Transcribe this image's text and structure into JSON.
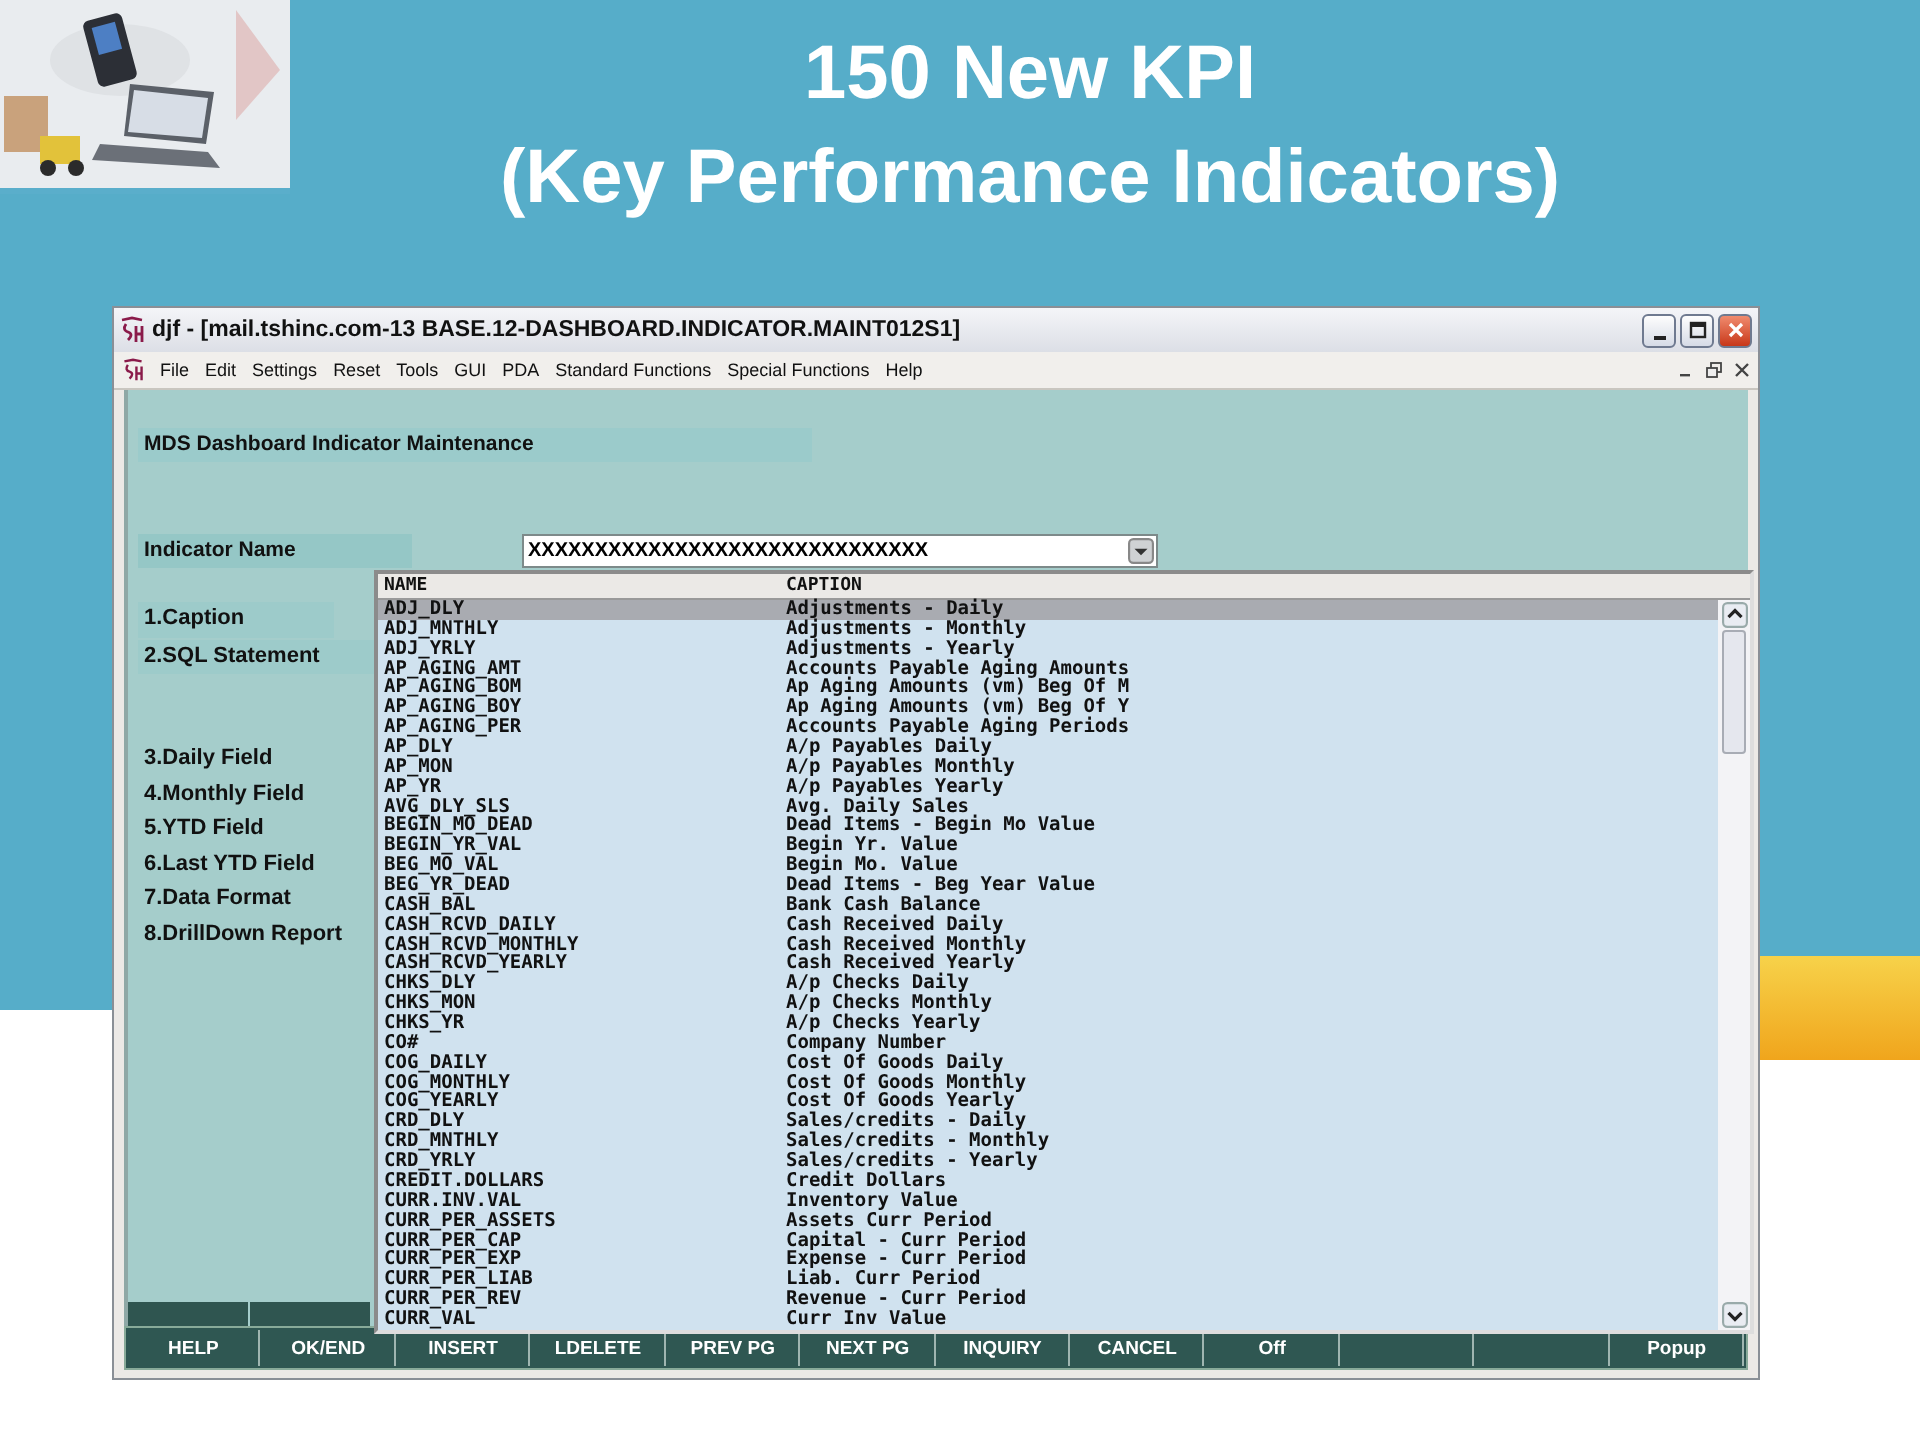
{
  "slide": {
    "title_lines": [
      "150 New KPI",
      "(Key Performance Indicators)"
    ]
  },
  "window": {
    "title": "djf - [mail.tshinc.com-13 BASE.12-DASHBOARD.INDICATOR.MAINT012S1]"
  },
  "menu": [
    "File",
    "Edit",
    "Settings",
    "Reset",
    "Tools",
    "GUI",
    "PDA",
    "Standard Functions",
    "Special Functions",
    "Help"
  ],
  "form": {
    "heading": "MDS Dashboard Indicator Maintenance",
    "indicator_label": "Indicator Name",
    "indicator_value": "XXXXXXXXXXXXXXXXXXXXXXXXXXXXXX",
    "fields": [
      "1.Caption",
      "2.SQL Statement",
      "3.Daily Field",
      "4.Monthly Field",
      "5.YTD Field",
      "6.Last YTD Field",
      "7.Data Format",
      "8.DrillDown Report"
    ]
  },
  "lookup": {
    "columns": [
      "NAME",
      "CAPTION"
    ],
    "rows": [
      {
        "name": "ADJ_DLY",
        "caption": "Adjustments - Daily",
        "selected": true
      },
      {
        "name": "ADJ_MNTHLY",
        "caption": "Adjustments - Monthly",
        "selected": false
      },
      {
        "name": "ADJ_YRLY",
        "caption": "Adjustments - Yearly",
        "selected": false
      },
      {
        "name": "AP_AGING_AMT",
        "caption": "Accounts Payable Aging Amounts",
        "selected": false
      },
      {
        "name": "AP_AGING_BOM",
        "caption": "Ap Aging Amounts (vm) Beg Of M",
        "selected": false
      },
      {
        "name": "AP_AGING_BOY",
        "caption": "Ap Aging Amounts (vm) Beg Of Y",
        "selected": false
      },
      {
        "name": "AP_AGING_PER",
        "caption": "Accounts Payable Aging Periods",
        "selected": false
      },
      {
        "name": "AP_DLY",
        "caption": "A/p Payables Daily",
        "selected": false
      },
      {
        "name": "AP_MON",
        "caption": "A/p Payables Monthly",
        "selected": false
      },
      {
        "name": "AP_YR",
        "caption": "A/p Payables Yearly",
        "selected": false
      },
      {
        "name": "AVG_DLY_SLS",
        "caption": "Avg. Daily Sales",
        "selected": false
      },
      {
        "name": "BEGIN_MO_DEAD",
        "caption": "Dead Items - Begin Mo Value",
        "selected": false
      },
      {
        "name": "BEGIN_YR_VAL",
        "caption": "Begin Yr. Value",
        "selected": false
      },
      {
        "name": "BEG_MO_VAL",
        "caption": "Begin Mo. Value",
        "selected": false
      },
      {
        "name": "BEG_YR_DEAD",
        "caption": "Dead Items - Beg Year Value",
        "selected": false
      },
      {
        "name": "CASH_BAL",
        "caption": "Bank Cash Balance",
        "selected": false
      },
      {
        "name": "CASH_RCVD_DAILY",
        "caption": "Cash Received Daily",
        "selected": false
      },
      {
        "name": "CASH_RCVD_MONTHLY",
        "caption": "Cash Received Monthly",
        "selected": false
      },
      {
        "name": "CASH_RCVD_YEARLY",
        "caption": "Cash Received Yearly",
        "selected": false
      },
      {
        "name": "CHKS_DLY",
        "caption": "A/p Checks Daily",
        "selected": false
      },
      {
        "name": "CHKS_MON",
        "caption": "A/p Checks Monthly",
        "selected": false
      },
      {
        "name": "CHKS_YR",
        "caption": "A/p Checks Yearly",
        "selected": false
      },
      {
        "name": "CO#",
        "caption": "Company Number",
        "selected": false
      },
      {
        "name": "COG_DAILY",
        "caption": "Cost Of Goods Daily",
        "selected": false
      },
      {
        "name": "COG_MONTHLY",
        "caption": "Cost Of Goods Monthly",
        "selected": false
      },
      {
        "name": "COG_YEARLY",
        "caption": "Cost Of Goods Yearly",
        "selected": false
      },
      {
        "name": "CRD_DLY",
        "caption": "Sales/credits - Daily",
        "selected": false
      },
      {
        "name": "CRD_MNTHLY",
        "caption": "Sales/credits - Monthly",
        "selected": false
      },
      {
        "name": "CRD_YRLY",
        "caption": "Sales/credits - Yearly",
        "selected": false
      },
      {
        "name": "CREDIT.DOLLARS",
        "caption": "Credit Dollars",
        "selected": false
      },
      {
        "name": "CURR.INV.VAL",
        "caption": "Inventory Value",
        "selected": false
      },
      {
        "name": "CURR_PER_ASSETS",
        "caption": "Assets Curr Period",
        "selected": false
      },
      {
        "name": "CURR_PER_CAP",
        "caption": "Capital - Curr Period",
        "selected": false
      },
      {
        "name": "CURR_PER_EXP",
        "caption": "Expense - Curr Period",
        "selected": false
      },
      {
        "name": "CURR_PER_LIAB",
        "caption": "Liab. Curr Period",
        "selected": false
      },
      {
        "name": "CURR_PER_REV",
        "caption": "Revenue - Curr Period",
        "selected": false
      },
      {
        "name": "CURR_VAL",
        "caption": "Curr Inv Value",
        "selected": false
      }
    ]
  },
  "function_keys": [
    {
      "kind": "key",
      "label": "HELP"
    },
    {
      "kind": "key",
      "label": "OK/END"
    },
    {
      "kind": "key",
      "label": "INSERT"
    },
    {
      "kind": "key",
      "label": "LDELETE"
    },
    {
      "kind": "key",
      "label": "PREV PG"
    },
    {
      "kind": "key",
      "label": "NEXT PG"
    },
    {
      "kind": "key",
      "label": "INQUIRY"
    },
    {
      "kind": "key",
      "label": "CANCEL"
    },
    {
      "kind": "key",
      "label": "Off"
    },
    {
      "kind": "blank"
    },
    {
      "kind": "blank"
    },
    {
      "kind": "key",
      "label": "Popup"
    }
  ]
}
